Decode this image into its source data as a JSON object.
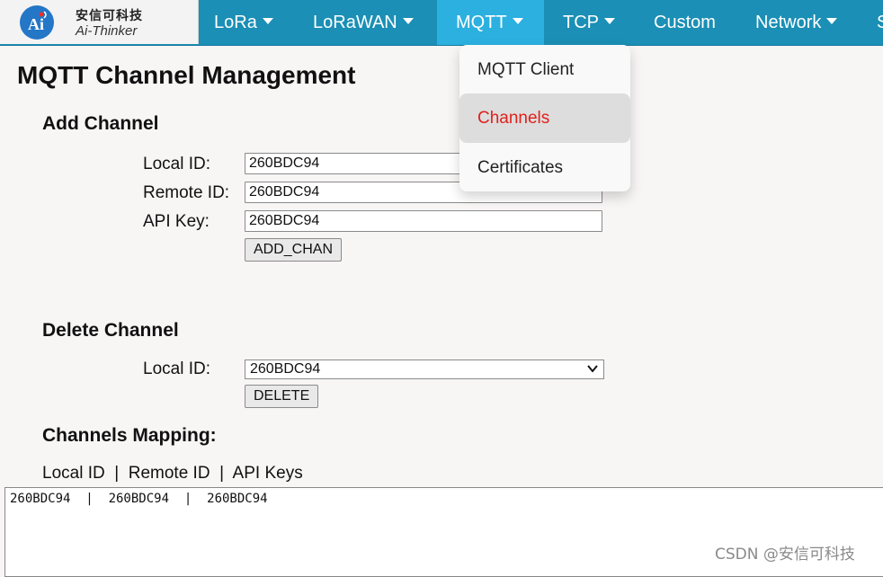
{
  "brand": {
    "name_cn": "安信可科技",
    "name_en": "Ai-Thinker"
  },
  "nav": {
    "items": [
      {
        "label": "LoRa",
        "has_caret": true
      },
      {
        "label": "LoRaWAN",
        "has_caret": true
      },
      {
        "label": "MQTT",
        "has_caret": true,
        "active": true
      },
      {
        "label": "TCP",
        "has_caret": true
      },
      {
        "label": "Custom",
        "has_caret": false
      },
      {
        "label": "Network",
        "has_caret": true
      },
      {
        "label": "S",
        "has_caret": false
      }
    ]
  },
  "dropdown": {
    "items": [
      {
        "label": "MQTT Client"
      },
      {
        "label": "Channels",
        "selected": true
      },
      {
        "label": "Certificates"
      }
    ]
  },
  "page": {
    "title": "MQTT Channel Management",
    "add_section": {
      "heading": "Add Channel",
      "local_id_label": "Local ID:",
      "local_id_value": "260BDC94",
      "remote_id_label": "Remote ID:",
      "remote_id_value": "260BDC94",
      "api_key_label": "API Key:",
      "api_key_value": "260BDC94",
      "button": "ADD_CHAN"
    },
    "delete_section": {
      "heading": "Delete Channel",
      "local_id_label": "Local ID:",
      "selected": "260BDC94",
      "button": "DELETE"
    },
    "mapping": {
      "heading": "Channels Mapping:",
      "columns": "Local ID  |  Remote ID  |  API Keys",
      "row": "260BDC94  |  260BDC94  |  260BDC94"
    }
  },
  "watermark": "CSDN @安信可科技",
  "colors": {
    "nav_bg": "#1b8fb5",
    "nav_active": "#2bb0e0",
    "selected_text": "#e0201c"
  }
}
